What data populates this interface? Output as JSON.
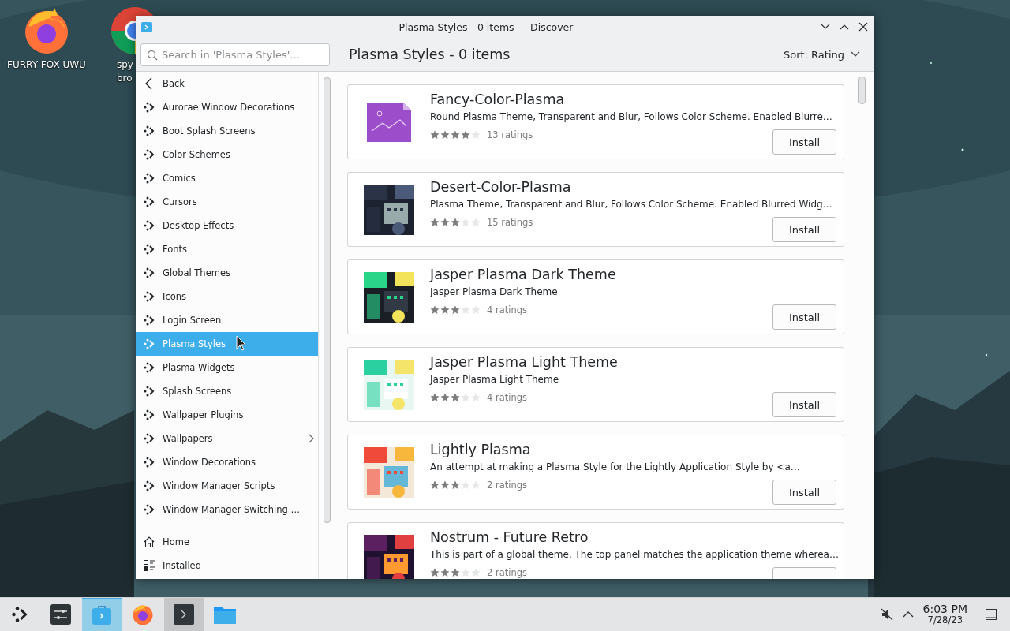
{
  "desktop": {
    "icons": [
      {
        "kind": "fox",
        "label": "FURRY FOX UWU"
      },
      {
        "kind": "chrome",
        "label": "spy\nbro"
      }
    ]
  },
  "window": {
    "title": "Plasma Styles - 0 items — Discover",
    "search": {
      "placeholder": "Search in 'Plasma Styles'…"
    },
    "heading": "Plasma Styles - 0 items",
    "sort": "Sort: Rating",
    "sidebar": {
      "items": [
        {
          "kind": "back",
          "label": "Back",
          "selected": false,
          "expandable": false
        },
        {
          "kind": "category",
          "label": "Aurorae Window Decorations",
          "selected": false,
          "expandable": false
        },
        {
          "kind": "category",
          "label": "Boot Splash Screens",
          "selected": false,
          "expandable": false
        },
        {
          "kind": "category",
          "label": "Color Schemes",
          "selected": false,
          "expandable": false
        },
        {
          "kind": "category",
          "label": "Comics",
          "selected": false,
          "expandable": false
        },
        {
          "kind": "category",
          "label": "Cursors",
          "selected": false,
          "expandable": false
        },
        {
          "kind": "category",
          "label": "Desktop Effects",
          "selected": false,
          "expandable": false
        },
        {
          "kind": "category",
          "label": "Fonts",
          "selected": false,
          "expandable": false
        },
        {
          "kind": "category",
          "label": "Global Themes",
          "selected": false,
          "expandable": false
        },
        {
          "kind": "category",
          "label": "Icons",
          "selected": false,
          "expandable": false
        },
        {
          "kind": "category",
          "label": "Login Screen",
          "selected": false,
          "expandable": false
        },
        {
          "kind": "category",
          "label": "Plasma Styles",
          "selected": true,
          "expandable": false
        },
        {
          "kind": "category",
          "label": "Plasma Widgets",
          "selected": false,
          "expandable": false
        },
        {
          "kind": "category",
          "label": "Splash Screens",
          "selected": false,
          "expandable": false
        },
        {
          "kind": "category",
          "label": "Wallpaper Plugins",
          "selected": false,
          "expandable": false
        },
        {
          "kind": "category",
          "label": "Wallpapers",
          "selected": false,
          "expandable": true
        },
        {
          "kind": "category",
          "label": "Window Decorations",
          "selected": false,
          "expandable": false
        },
        {
          "kind": "category",
          "label": "Window Manager Scripts",
          "selected": false,
          "expandable": false
        },
        {
          "kind": "category",
          "label": "Window Manager Switching …",
          "selected": false,
          "expandable": false
        }
      ],
      "footer": [
        {
          "kind": "home",
          "label": "Home",
          "selected": false,
          "expandable": false
        },
        {
          "kind": "installed",
          "label": "Installed",
          "selected": false,
          "expandable": false
        }
      ]
    },
    "cards": [
      {
        "name": "Fancy-Color-Plasma",
        "description": "Round Plasma Theme, Transparent and Blur, Follows Color Scheme. Enabled Blurre…",
        "stars": 4,
        "ratings": "13 ratings",
        "kind": "icon",
        "button": "Install"
      },
      {
        "name": "Desert-Color-Plasma",
        "description": "Plasma Theme, Transparent and Blur, Follows Color Scheme. Enabled Blurred Widg…",
        "stars": 3,
        "ratings": "15 ratings",
        "kind": "picture",
        "button": "Install"
      },
      {
        "name": "Jasper Plasma Dark Theme",
        "description": "Jasper Plasma Dark Theme",
        "stars": 3,
        "ratings": "4 ratings",
        "kind": "picture",
        "button": "Install"
      },
      {
        "name": "Jasper Plasma Light Theme",
        "description": "Jasper Plasma Light Theme",
        "stars": 3,
        "ratings": "4 ratings",
        "kind": "picture",
        "button": "Install"
      },
      {
        "name": "Lightly Plasma",
        "description": "An attempt at making a Plasma Style for the Lightly Application Style by <a…",
        "stars": 3,
        "ratings": "2 ratings",
        "kind": "picture",
        "button": "Install"
      },
      {
        "name": "Nostrum - Future Retro",
        "description": "This is part of a global theme. The top panel matches the application theme wherea…",
        "stars": 3,
        "ratings": "2 ratings",
        "kind": "picture"
      }
    ]
  },
  "taskbar": {
    "apps": [
      {
        "kind": "launcher",
        "selected": false,
        "hovered": false
      },
      {
        "kind": "settings",
        "selected": false,
        "hovered": false
      },
      {
        "kind": "discover",
        "selected": true,
        "hovered": false
      },
      {
        "kind": "fox",
        "selected": false,
        "hovered": false
      },
      {
        "kind": "terminal",
        "selected": false,
        "hovered": true
      },
      {
        "kind": "folder",
        "selected": false,
        "hovered": false
      }
    ],
    "tray": {
      "time": "6:03 PM",
      "date": "7/28/23"
    }
  }
}
